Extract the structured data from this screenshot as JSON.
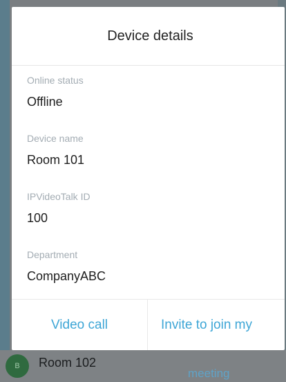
{
  "dialog": {
    "title": "Device details",
    "fields": [
      {
        "label": "Online status",
        "value": "Offline"
      },
      {
        "label": "Device name",
        "value": "Room 101"
      },
      {
        "label": "IPVideoTalk ID",
        "value": "100"
      },
      {
        "label": "Department",
        "value": "CompanyABC"
      }
    ],
    "actions": {
      "video_call": "Video call",
      "invite": "Invite to join my"
    }
  },
  "background": {
    "list_item": {
      "avatar_text": "B",
      "name": "Room 102",
      "status": "meeting"
    }
  }
}
